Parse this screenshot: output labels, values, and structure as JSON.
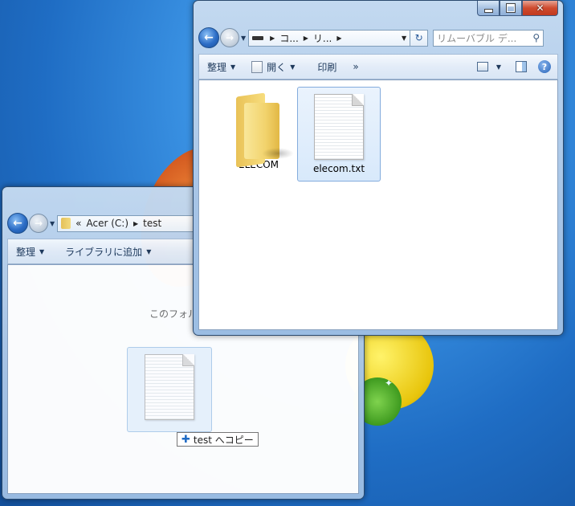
{
  "front_window": {
    "address": {
      "crumbs": [
        "コ...",
        "リ..."
      ]
    },
    "search_placeholder": "リムーバブル デ...",
    "toolbar": {
      "organize": "整理",
      "open": "開く",
      "print": "印刷",
      "more": "»"
    },
    "items": [
      {
        "label": "ELECOM",
        "type": "folder"
      },
      {
        "label": "elecom.txt",
        "type": "text-file",
        "selected": true
      }
    ]
  },
  "back_window": {
    "address": {
      "crumb_overflow": "«",
      "crumbs": [
        "Acer (C:)",
        "test"
      ]
    },
    "toolbar": {
      "organize": "整理",
      "add_to_library": "ライブラリに追加"
    },
    "empty_message": "このフォルダー"
  },
  "drag_tooltip": {
    "label": "test へコピー"
  },
  "colors": {
    "titlebar": "#a6c4e6",
    "selection": "#d8e9fb",
    "close_button": "#cf4a2e",
    "desktop": "#2a7fd6"
  },
  "icons": [
    "back-arrow-icon",
    "forward-arrow-icon",
    "folder-icon",
    "text-file-icon",
    "refresh-icon",
    "search-icon",
    "help-icon",
    "plus-icon"
  ]
}
